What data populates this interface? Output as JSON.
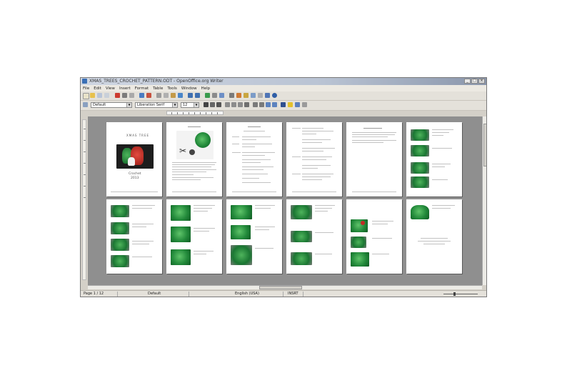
{
  "window": {
    "title": "XMAS_TREES_CROCHET_PATTERN.ODT - OpenOffice.org Writer",
    "controls": [
      "_",
      "□",
      "×"
    ]
  },
  "menu": [
    "File",
    "Edit",
    "View",
    "Insert",
    "Format",
    "Table",
    "Tools",
    "Window",
    "Help"
  ],
  "format_toolbar": {
    "style": "Default",
    "font": "Liberation Serif",
    "size": "12"
  },
  "pages_row1": [
    {
      "type": "cover",
      "title": "XMAS TREE",
      "subtitle": "Crochet",
      "sub2": "2013"
    },
    {
      "type": "materials"
    },
    {
      "type": "text"
    },
    {
      "type": "text"
    },
    {
      "type": "text-short"
    },
    {
      "type": "photos-right"
    }
  ],
  "pages_row2": [
    {
      "type": "photos-left",
      "count": 4
    },
    {
      "type": "photos-left",
      "count": 3
    },
    {
      "type": "photos-left",
      "count": 3
    },
    {
      "type": "photos-left",
      "count": 3
    },
    {
      "type": "photos-left",
      "count": 3
    },
    {
      "type": "final"
    }
  ],
  "status": {
    "page": "Page 1 / 12",
    "style": "Default",
    "language": "English (USA)",
    "mode": "INSRT",
    "zoom": "Zoom"
  },
  "colors": {
    "canvas": "#8f8f8f",
    "toolbar": "#e4e1da",
    "crochet_green": "#22893a",
    "accent_red": "#c22a23"
  },
  "icons": [
    "new-icon",
    "open-icon",
    "save-icon",
    "print-icon",
    "cut-icon",
    "copy-icon",
    "paste-icon",
    "undo-icon",
    "redo-icon",
    "bold-icon",
    "italic-icon",
    "underline-icon",
    "align-left-icon",
    "align-center-icon",
    "align-right-icon",
    "justify-icon"
  ]
}
